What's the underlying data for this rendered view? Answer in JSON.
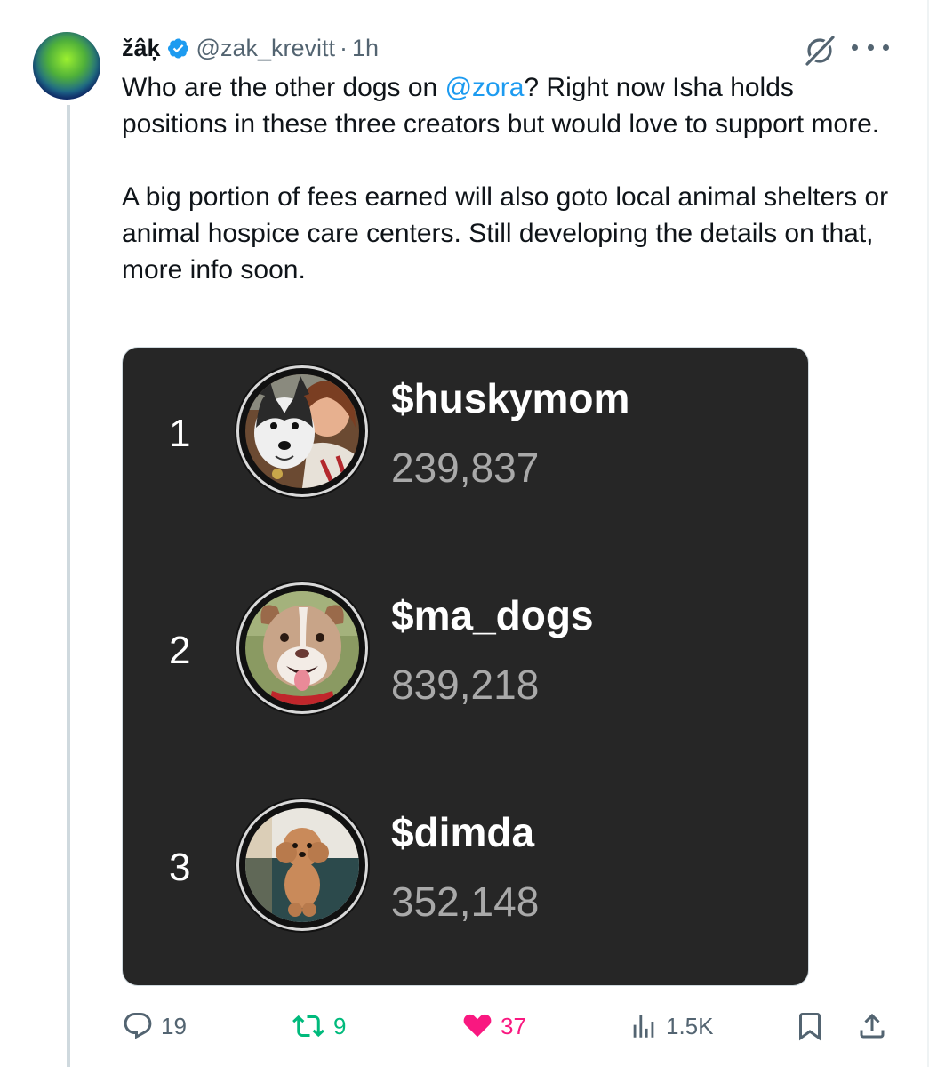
{
  "tweet": {
    "author": {
      "display_name": "žâķ",
      "handle": "@zak_krevitt",
      "time": "1h",
      "separator": "·"
    },
    "text": {
      "line1_prefix": "Who are the other dogs on ",
      "mention": "@zora",
      "line1_suffix": "? Right now Isha holds positions in these three creators but would love to support more.",
      "paragraph2": "A big portion of fees earned will also goto local animal shelters or animal hospice care centers. Still developing the details on that, more info soon."
    },
    "leaderboard": [
      {
        "rank": "1",
        "name": "$huskymom",
        "count": "239,837"
      },
      {
        "rank": "2",
        "name": "$ma_dogs",
        "count": "839,218"
      },
      {
        "rank": "3",
        "name": "$dimda",
        "count": "352,148"
      }
    ],
    "actions": {
      "replies": "19",
      "reposts": "9",
      "likes": "37",
      "views": "1.5K"
    }
  },
  "icons": {
    "reply": "reply-icon",
    "repost": "repost-icon",
    "like": "heart-icon",
    "views": "views-icon",
    "bookmark": "bookmark-icon",
    "share": "share-icon",
    "grok": "grok-icon",
    "more": "more-icon",
    "verified": "verified-badge-icon"
  },
  "colors": {
    "accent": "#1d9bf0",
    "like": "#f91880",
    "repost": "#00ba7c",
    "muted": "#536471",
    "card_bg": "#262626"
  }
}
